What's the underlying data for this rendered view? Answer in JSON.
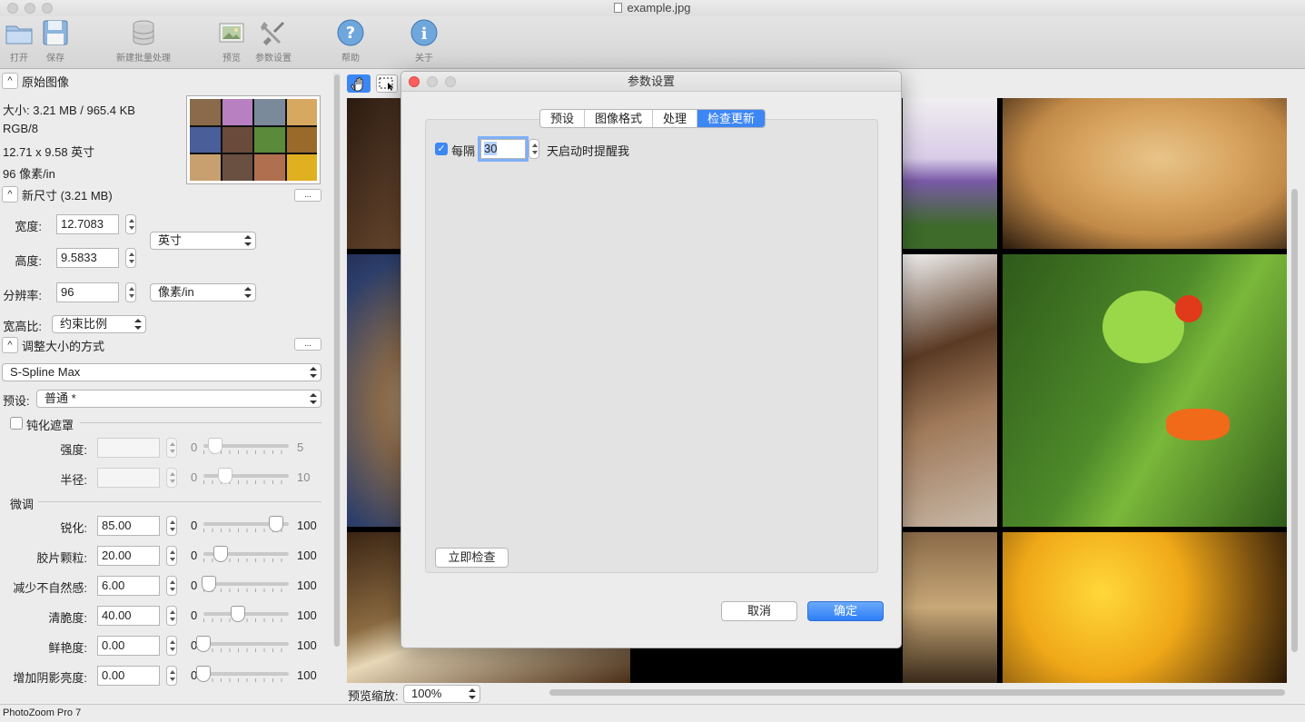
{
  "window": {
    "title": "example.jpg"
  },
  "toolbar": {
    "open": "打开",
    "save": "保存",
    "batch": "新建批量处理",
    "preview": "预览",
    "settings": "参数设置",
    "help": "帮助",
    "about": "关于"
  },
  "original": {
    "header": "原始图像",
    "size": "大小: 3.21 MB / 965.4 KB",
    "mode": "RGB/8",
    "dims": "12.71 x 9.58 英寸",
    "res": "96 像素/in"
  },
  "newsize": {
    "header": "新尺寸 (3.21 MB)",
    "more": "...",
    "width_label": "宽度:",
    "width_value": "12.7083",
    "height_label": "高度:",
    "height_value": "9.5833",
    "unit": "英寸",
    "res_label": "分辨率:",
    "res_value": "96",
    "res_unit": "像素/in",
    "aspect_label": "宽高比:",
    "aspect_value": "约束比例"
  },
  "resize": {
    "header": "调整大小的方式",
    "more": "...",
    "method": "S-Spline Max",
    "preset_label": "预设:",
    "preset_value": "普通 *"
  },
  "unsharp": {
    "label": "钝化遮罩",
    "rows": [
      {
        "label": "强度:",
        "value": "",
        "min": "0",
        "max": "5",
        "level": 0.14
      },
      {
        "label": "半径:",
        "value": "",
        "min": "0",
        "max": "10",
        "level": 0.25
      }
    ]
  },
  "finetune": {
    "label": "微调",
    "rows": [
      {
        "label": "锐化:",
        "value": "85.00",
        "min": "0",
        "max": "100",
        "level": 0.85
      },
      {
        "label": "胶片颗粒:",
        "value": "20.00",
        "min": "0",
        "max": "100",
        "level": 0.2
      },
      {
        "label": "减少不自然感:",
        "value": "6.00",
        "min": "0",
        "max": "100",
        "level": 0.06
      },
      {
        "label": "清脆度:",
        "value": "40.00",
        "min": "0",
        "max": "100",
        "level": 0.4
      },
      {
        "label": "鲜艳度:",
        "value": "0.00",
        "min": "0",
        "max": "100",
        "level": 0.0
      },
      {
        "label": "增加阴影亮度:",
        "value": "0.00",
        "min": "0",
        "max": "100",
        "level": 0.0
      }
    ]
  },
  "preview": {
    "zoom_label": "预览缩放:",
    "zoom_value": "100%"
  },
  "status": {
    "app": "PhotoZoom Pro 7"
  },
  "dialog": {
    "title": "参数设置",
    "tabs": [
      "预设",
      "图像格式",
      "处理",
      "检查更新"
    ],
    "active_tab": "检查更新",
    "every_label": "每隔",
    "days_value": "30",
    "remind_label": "天启动时提醒我",
    "check_now": "立即检查",
    "cancel": "取消",
    "ok": "确定"
  },
  "colors": {
    "accent": "#3d87f5",
    "close": "#fc605c"
  }
}
